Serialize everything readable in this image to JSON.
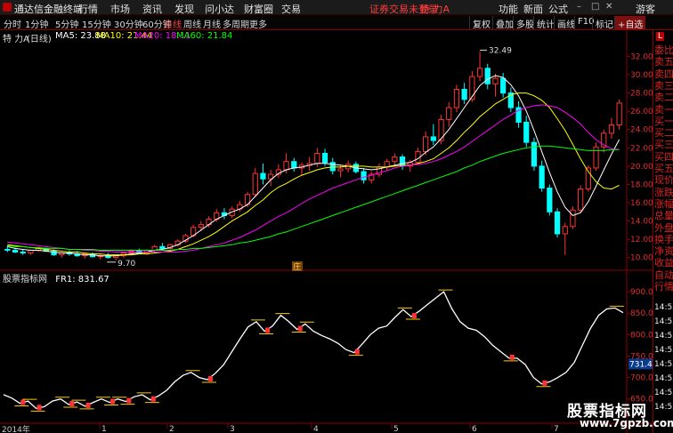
{
  "menubar": {
    "title": "通达信金融终端",
    "items": [
      "行情",
      "市场",
      "资讯",
      "发现",
      "问小达",
      "财富圈",
      "交易"
    ],
    "notice": "证券交易未登录",
    "stock_name": "特 力A",
    "right_items": [
      "功能",
      "新面",
      "公式",
      "游客"
    ]
  },
  "toolbar": {
    "periods": [
      "分时",
      "1分钟",
      "5分钟",
      "15分钟",
      "30分钟",
      "60分钟",
      "日线",
      "周线",
      "月线",
      "多周期",
      "更多"
    ],
    "active_period": "日线",
    "right_buttons": [
      "复权",
      "叠加",
      "多股",
      "统计",
      "画线",
      "F10",
      "标记",
      "+自选"
    ]
  },
  "infobar": {
    "stock": "特 力A",
    "period": "(日线)",
    "ma5": "MA5: 23.88",
    "ma10": "MA10: 21.44",
    "ma20": "MA20: 18.11",
    "ma60": "MA60: 21.84"
  },
  "lower_info": {
    "indicator": "股票指标网",
    "fr1": "FR1: 831.67"
  },
  "colors": {
    "up": "#ff3333",
    "down": "#00ffff",
    "ma5": "#ffffff",
    "ma10": "#ffff00",
    "ma20": "#ff00ff",
    "ma60": "#00ff00",
    "axis": "#8b0000",
    "axis_text": "#e03030"
  },
  "chart_data": {
    "type": "candlestick",
    "price_axis": {
      "ticks": [
        "32.00",
        "30.00",
        "28.00",
        "26.00",
        "24.00",
        "22.00",
        "20.00",
        "18.00",
        "16.00",
        "14.00",
        "12.00",
        "10.00"
      ],
      "ylim": [
        9.0,
        33.5
      ]
    },
    "annotations": {
      "high": "32.49",
      "low": "9.70",
      "marker": "庄"
    },
    "candles_ohlc_approx": [
      [
        10.9,
        11.3,
        10.6,
        10.8
      ],
      [
        10.8,
        11.1,
        10.5,
        10.6
      ],
      [
        10.6,
        10.9,
        10.3,
        10.5
      ],
      [
        10.5,
        10.9,
        10.3,
        10.8
      ],
      [
        10.8,
        11.2,
        10.6,
        11.0
      ],
      [
        11.0,
        11.1,
        10.6,
        10.7
      ],
      [
        10.7,
        10.9,
        10.2,
        10.3
      ],
      [
        10.3,
        10.6,
        10.0,
        10.5
      ],
      [
        10.5,
        10.8,
        10.2,
        10.4
      ],
      [
        10.4,
        10.7,
        10.1,
        10.2
      ],
      [
        10.2,
        10.5,
        9.9,
        10.4
      ],
      [
        10.4,
        10.6,
        10.0,
        10.1
      ],
      [
        10.1,
        10.4,
        9.8,
        10.2
      ],
      [
        10.2,
        10.5,
        9.9,
        10.0
      ],
      [
        10.0,
        10.3,
        9.7,
        10.2
      ],
      [
        10.2,
        10.6,
        10.0,
        10.5
      ],
      [
        10.5,
        10.9,
        10.3,
        10.7
      ],
      [
        10.7,
        11.0,
        10.4,
        10.5
      ],
      [
        10.5,
        10.9,
        10.3,
        10.8
      ],
      [
        10.8,
        11.4,
        10.6,
        11.2
      ],
      [
        11.2,
        11.6,
        10.9,
        11.0
      ],
      [
        11.0,
        11.5,
        10.8,
        11.4
      ],
      [
        11.4,
        12.0,
        11.2,
        11.8
      ],
      [
        11.8,
        12.6,
        11.6,
        12.4
      ],
      [
        12.4,
        13.6,
        12.2,
        13.3
      ],
      [
        13.3,
        14.0,
        12.9,
        13.6
      ],
      [
        13.6,
        14.5,
        13.3,
        14.2
      ],
      [
        14.2,
        15.3,
        13.9,
        14.9
      ],
      [
        14.9,
        15.4,
        14.2,
        14.6
      ],
      [
        14.6,
        15.6,
        14.3,
        15.3
      ],
      [
        15.3,
        16.2,
        15.0,
        15.8
      ],
      [
        15.8,
        17.2,
        15.5,
        16.9
      ],
      [
        16.9,
        19.8,
        16.6,
        19.2
      ],
      [
        19.2,
        20.3,
        18.0,
        18.6
      ],
      [
        18.6,
        19.6,
        17.8,
        19.1
      ],
      [
        19.1,
        20.2,
        18.7,
        19.6
      ],
      [
        19.6,
        21.4,
        19.2,
        20.5
      ],
      [
        20.5,
        20.9,
        19.4,
        19.8
      ],
      [
        19.8,
        20.4,
        19.0,
        20.1
      ],
      [
        20.1,
        21.0,
        19.5,
        20.3
      ],
      [
        20.3,
        22.0,
        19.9,
        21.4
      ],
      [
        21.4,
        21.9,
        20.0,
        20.4
      ],
      [
        20.4,
        20.9,
        19.1,
        19.5
      ],
      [
        19.5,
        20.1,
        18.8,
        19.7
      ],
      [
        19.7,
        20.6,
        19.3,
        20.2
      ],
      [
        20.2,
        20.5,
        19.2,
        19.4
      ],
      [
        19.4,
        19.8,
        18.1,
        18.5
      ],
      [
        18.5,
        19.4,
        18.1,
        19.1
      ],
      [
        19.1,
        20.3,
        18.8,
        19.9
      ],
      [
        19.9,
        20.8,
        19.5,
        20.5
      ],
      [
        20.5,
        21.4,
        20.0,
        21.0
      ],
      [
        21.0,
        21.3,
        19.6,
        20.0
      ],
      [
        20.0,
        20.7,
        19.4,
        20.4
      ],
      [
        20.4,
        22.0,
        20.1,
        21.6
      ],
      [
        21.6,
        23.8,
        21.2,
        23.2
      ],
      [
        23.2,
        24.6,
        22.3,
        22.8
      ],
      [
        22.8,
        25.6,
        22.4,
        25.1
      ],
      [
        25.1,
        27.0,
        24.3,
        26.4
      ],
      [
        26.4,
        28.9,
        25.9,
        28.4
      ],
      [
        28.4,
        29.1,
        26.8,
        27.3
      ],
      [
        27.3,
        30.4,
        27.0,
        29.8
      ],
      [
        29.8,
        32.49,
        29.3,
        30.7
      ],
      [
        30.7,
        31.2,
        28.4,
        29.0
      ],
      [
        29.0,
        30.1,
        27.6,
        29.6
      ],
      [
        29.6,
        30.2,
        27.5,
        28.0
      ],
      [
        28.0,
        28.6,
        25.9,
        26.4
      ],
      [
        26.4,
        27.1,
        24.2,
        24.8
      ],
      [
        24.8,
        25.5,
        22.1,
        22.6
      ],
      [
        22.6,
        23.1,
        19.5,
        20.0
      ],
      [
        20.0,
        20.6,
        17.2,
        17.6
      ],
      [
        17.6,
        18.0,
        14.6,
        15.0
      ],
      [
        15.0,
        15.4,
        12.2,
        12.6
      ],
      [
        12.6,
        13.8,
        10.3,
        13.4
      ],
      [
        13.4,
        15.6,
        13.1,
        15.2
      ],
      [
        15.2,
        17.9,
        14.9,
        17.5
      ],
      [
        17.5,
        20.1,
        17.2,
        19.8
      ],
      [
        19.8,
        22.6,
        19.5,
        22.1
      ],
      [
        22.1,
        24.0,
        21.5,
        23.6
      ],
      [
        23.6,
        25.3,
        23.0,
        24.5
      ],
      [
        24.5,
        27.3,
        24.0,
        26.9
      ]
    ],
    "ma_series": [
      {
        "name": "MA5",
        "values": [
          11.2,
          11.0,
          10.9,
          10.8,
          10.8,
          10.7,
          10.6,
          10.5,
          10.5,
          10.4,
          10.3,
          10.3,
          10.2,
          10.2,
          10.2,
          10.3,
          10.4,
          10.5,
          10.6,
          10.8,
          10.9,
          11.1,
          11.4,
          11.9,
          12.4,
          13.0,
          13.6,
          14.2,
          14.6,
          15.0,
          15.3,
          15.8,
          16.7,
          17.6,
          18.5,
          19.2,
          19.6,
          19.8,
          19.9,
          20.1,
          20.3,
          20.3,
          20.2,
          20.1,
          20.0,
          19.8,
          19.7,
          19.6,
          19.7,
          19.9,
          20.1,
          20.3,
          20.4,
          20.8,
          21.5,
          22.1,
          23.0,
          24.0,
          25.2,
          26.4,
          27.6,
          28.8,
          29.5,
          29.9,
          29.7,
          28.9,
          27.7,
          26.0,
          23.9,
          21.6,
          19.3,
          17.2,
          15.5,
          14.6,
          14.9,
          16.1,
          17.8,
          19.6,
          21.3,
          22.9
        ]
      },
      {
        "name": "MA10",
        "values": [
          11.4,
          11.3,
          11.2,
          11.1,
          11.0,
          10.9,
          10.8,
          10.7,
          10.6,
          10.6,
          10.5,
          10.4,
          10.4,
          10.3,
          10.3,
          10.3,
          10.3,
          10.4,
          10.4,
          10.5,
          10.6,
          10.7,
          10.9,
          11.2,
          11.5,
          11.9,
          12.3,
          12.8,
          13.4,
          14.0,
          14.5,
          15.0,
          15.7,
          16.3,
          17.1,
          17.7,
          18.1,
          18.6,
          19.0,
          19.3,
          19.6,
          19.8,
          19.9,
          19.9,
          20.0,
          20.0,
          20.0,
          19.9,
          19.9,
          19.9,
          20.0,
          20.1,
          20.1,
          20.3,
          20.5,
          20.8,
          21.4,
          22.0,
          22.8,
          23.7,
          24.5,
          25.4,
          26.1,
          26.8,
          27.3,
          27.8,
          28.0,
          28.0,
          27.7,
          27.2,
          26.4,
          25.2,
          23.9,
          22.4,
          20.8,
          19.4,
          18.3,
          17.6,
          17.5,
          17.9
        ]
      },
      {
        "name": "MA20",
        "values": [
          11.7,
          11.6,
          11.5,
          11.4,
          11.3,
          11.2,
          11.1,
          11.0,
          10.9,
          10.9,
          10.8,
          10.8,
          10.7,
          10.7,
          10.6,
          10.6,
          10.6,
          10.6,
          10.6,
          10.6,
          10.6,
          10.6,
          10.6,
          10.7,
          10.8,
          11.0,
          11.2,
          11.4,
          11.6,
          11.9,
          12.2,
          12.6,
          13.0,
          13.5,
          14.0,
          14.5,
          14.9,
          15.4,
          15.9,
          16.4,
          16.8,
          17.2,
          17.6,
          17.9,
          18.2,
          18.5,
          18.8,
          19.0,
          19.3,
          19.5,
          19.8,
          20.0,
          20.1,
          20.2,
          20.3,
          20.5,
          20.8,
          21.2,
          21.6,
          22.1,
          22.7,
          23.3,
          23.9,
          24.5,
          25.1,
          25.6,
          26.1,
          26.4,
          26.6,
          26.7,
          26.6,
          26.4,
          25.9,
          25.3,
          24.6,
          23.7,
          22.9,
          22.3,
          21.9,
          21.8
        ]
      },
      {
        "name": "MA60",
        "values": [
          11.3,
          11.2,
          11.2,
          11.1,
          11.1,
          11.0,
          11.0,
          11.0,
          10.9,
          10.9,
          10.9,
          10.9,
          10.8,
          10.8,
          10.8,
          10.8,
          10.8,
          10.8,
          10.8,
          10.8,
          10.8,
          10.8,
          10.9,
          10.9,
          11.0,
          11.0,
          11.1,
          11.2,
          11.3,
          11.4,
          11.6,
          11.7,
          11.9,
          12.1,
          12.3,
          12.6,
          12.8,
          13.1,
          13.4,
          13.7,
          14.0,
          14.3,
          14.6,
          14.9,
          15.2,
          15.5,
          15.8,
          16.1,
          16.4,
          16.7,
          17.0,
          17.3,
          17.6,
          17.9,
          18.2,
          18.5,
          18.8,
          19.1,
          19.4,
          19.8,
          20.1,
          20.5,
          20.8,
          21.1,
          21.4,
          21.6,
          21.8,
          22.0,
          22.1,
          22.2,
          22.2,
          22.1,
          22.0,
          21.9,
          21.8,
          21.7,
          21.7,
          21.7,
          21.8,
          21.8
        ]
      }
    ],
    "indicator": {
      "name": "FR1",
      "ticks": [
        "900.0",
        "850.0",
        "800.0",
        "750.0",
        "700.0",
        "650.0"
      ],
      "ylim": [
        610,
        925
      ],
      "value_label": "731.45",
      "values": [
        660,
        652,
        640,
        645,
        628,
        632,
        645,
        650,
        637,
        643,
        633,
        642,
        650,
        642,
        650,
        644,
        655,
        660,
        648,
        657,
        670,
        690,
        705,
        712,
        700,
        695,
        710,
        730,
        760,
        790,
        818,
        830,
        808,
        820,
        845,
        830,
        812,
        825,
        808,
        798,
        790,
        780,
        765,
        758,
        778,
        800,
        815,
        820,
        840,
        858,
        842,
        855,
        870,
        885,
        900,
        860,
        830,
        815,
        810,
        795,
        775,
        760,
        745,
        745,
        730,
        700,
        685,
        690,
        700,
        712,
        735,
        775,
        815,
        845,
        860,
        862,
        851
      ],
      "band_marks": [
        "B"
      ]
    },
    "x_ticks": [
      "2014年",
      "1",
      "2",
      "3",
      "4",
      "5",
      "6",
      "7"
    ]
  },
  "sidebar": {
    "top_badge": "L",
    "labels": [
      "委比",
      "卖五",
      "卖四",
      "卖三",
      "卖二",
      "卖一",
      "买一",
      "买二",
      "买三",
      "买四",
      "买五",
      "现价",
      "涨跌",
      "涨幅",
      "总量",
      "外盘",
      "换手",
      "净资",
      "收益",
      "自动",
      "行情"
    ],
    "right_times": [
      "14:55",
      "14:55",
      "14:55",
      "14:55",
      "14:55",
      "14:55",
      "14:55",
      "14:55"
    ]
  },
  "watermark": {
    "line1": "股票指标网",
    "line2": "www.7gpzb.com"
  }
}
